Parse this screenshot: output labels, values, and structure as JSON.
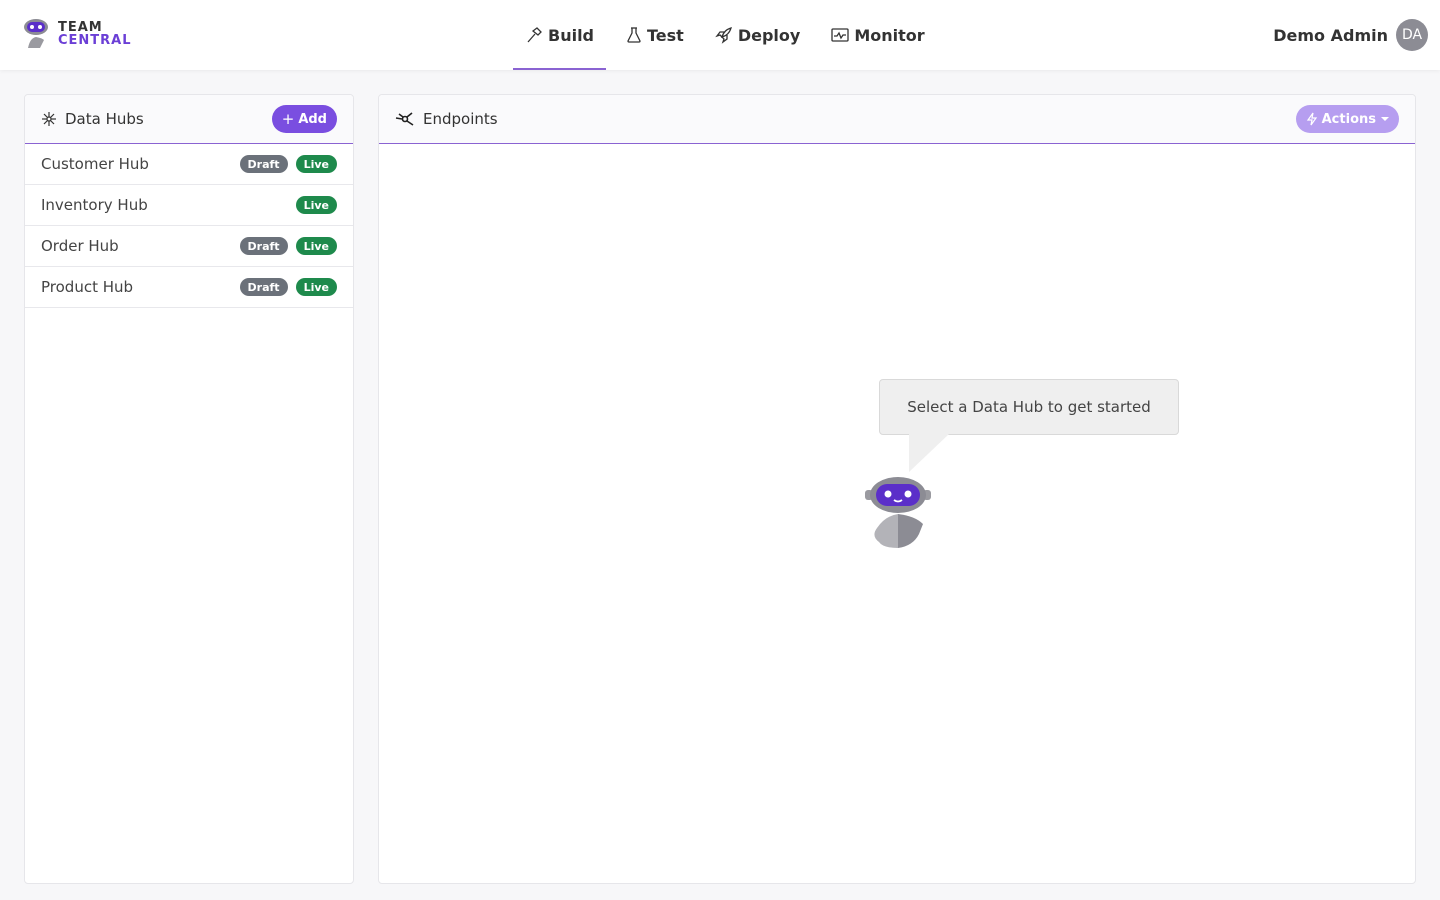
{
  "brand": {
    "line1": "TEAM",
    "line2": "CENTRAL"
  },
  "nav": [
    {
      "label": "Build",
      "icon": "hammer-icon",
      "active": true
    },
    {
      "label": "Test",
      "icon": "flask-icon",
      "active": false
    },
    {
      "label": "Deploy",
      "icon": "rocket-icon",
      "active": false
    },
    {
      "label": "Monitor",
      "icon": "monitor-icon",
      "active": false
    }
  ],
  "user": {
    "name": "Demo Admin",
    "initials": "DA"
  },
  "left_panel": {
    "title": "Data Hubs",
    "add_label": "Add",
    "hubs": [
      {
        "name": "Customer Hub",
        "draft": "Draft",
        "live": "Live"
      },
      {
        "name": "Inventory Hub",
        "live": "Live"
      },
      {
        "name": "Order Hub",
        "draft": "Draft",
        "live": "Live"
      },
      {
        "name": "Product Hub",
        "draft": "Draft",
        "live": "Live"
      }
    ]
  },
  "right_panel": {
    "title": "Endpoints",
    "actions_label": "Actions",
    "empty_message": "Select a Data Hub to get started"
  },
  "colors": {
    "accent": "#7a4ee0",
    "live": "#1e8a4c",
    "draft": "#6b717a"
  }
}
